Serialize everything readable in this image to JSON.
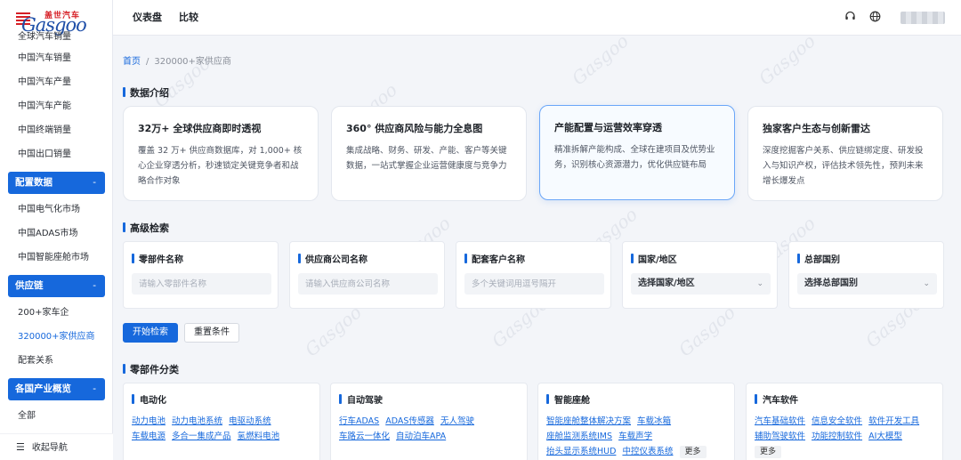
{
  "brand": {
    "logo_cn": "盖世汽车",
    "logo_en": "Gasgoo",
    "watermark": "Gasgoo"
  },
  "sidebar": {
    "items_top": [
      "全球汽车销量",
      "中国汽车销量",
      "中国汽车产量",
      "中国汽车产能",
      "中国终端销量",
      "中国出口销量"
    ],
    "group_config": {
      "label": "配置数据",
      "toggle": "-"
    },
    "items_config": [
      "中国电气化市场",
      "中国ADAS市场",
      "中国智能座舱市场"
    ],
    "group_supply": {
      "label": "供应链",
      "toggle": "-"
    },
    "items_supply": [
      "200+家车企",
      "320000+家供应商",
      "配套关系"
    ],
    "group_industry": {
      "label": "各国产业概览",
      "toggle": "-"
    },
    "items_industry": [
      "全部"
    ],
    "collapse_label": "收起导航",
    "active_item": "320000+家供应商"
  },
  "header": {
    "tabs": [
      "仪表盘",
      "比较"
    ]
  },
  "breadcrumb": {
    "home": "首页",
    "sep": "/",
    "current": "320000+家供应商"
  },
  "intro": {
    "title": "数据介绍",
    "cards": [
      {
        "title": "32万+ 全球供应商即时透视",
        "desc": "覆盖 32 万+ 供应商数据库，对 1,000+ 核心企业穿透分析，秒速锁定关键竞争者和战略合作对象"
      },
      {
        "title": "360° 供应商风险与能力全息图",
        "desc": "集成战略、财务、研发、产能、客户等关键数据，一站式掌握企业运营健康度与竞争力"
      },
      {
        "title": "产能配置与运营效率穿透",
        "desc": "精准拆解产能构成、全球在建项目及优势业务，识别核心资源潜力，优化供应链布局"
      },
      {
        "title": "独家客户生态与创新雷达",
        "desc": "深度挖掘客户关系、供应链绑定度、研发投入与知识产权，评估技术领先性，预判未来增长爆发点"
      }
    ]
  },
  "search": {
    "title": "高级检索",
    "fields": [
      {
        "label": "零部件名称",
        "placeholder": "请输入零部件名称"
      },
      {
        "label": "供应商公司名称",
        "placeholder": "请输入供应商公司名称"
      },
      {
        "label": "配套客户名称",
        "placeholder": "多个关键词用逗号隔开"
      }
    ],
    "selects": [
      {
        "label": "国家/地区",
        "value": "选择国家/地区"
      },
      {
        "label": "总部国别",
        "value": "选择总部国别"
      }
    ],
    "search_button": "开始检索",
    "reset_button": "重置条件"
  },
  "categories": {
    "title": "零部件分类",
    "groups": [
      {
        "title": "电动化",
        "links": [
          "动力电池",
          "动力电池系统",
          "电驱动系统",
          "车载电源",
          "多合一集成产品",
          "氢燃料电池"
        ]
      },
      {
        "title": "自动驾驶",
        "links": [
          "行车ADAS",
          "ADAS传感器",
          "无人驾驶",
          "车路云一体化",
          "自动泊车APA"
        ]
      },
      {
        "title": "智能座舱",
        "links": [
          "智能座舱整体解决方案",
          "车载冰箱",
          "座舱监测系统IMS",
          "车载声学",
          "抬头显示系统HUD",
          "中控仪表系统"
        ],
        "more": "更多"
      },
      {
        "title": "汽车软件",
        "links": [
          "汽车基础软件",
          "信息安全软件",
          "软件开发工具",
          "辅助驾驶软件",
          "功能控制软件",
          "AI大模型"
        ],
        "more": "更多"
      }
    ]
  }
}
